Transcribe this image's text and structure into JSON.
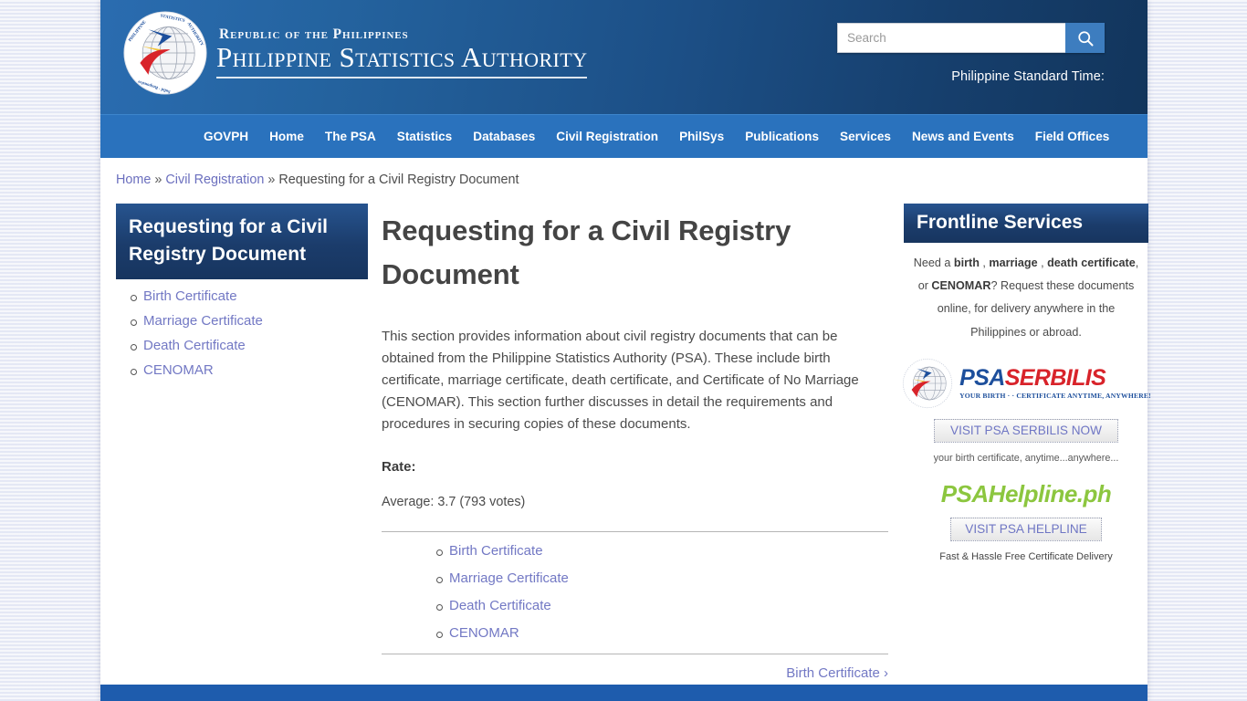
{
  "masthead": {
    "seal_icon": "psa-seal-icon",
    "sub_title": "Republic of the Philippines",
    "main_title": "Philippine Statistics Authority",
    "search": {
      "placeholder": "Search",
      "value": "",
      "button_icon": "search-icon"
    },
    "standard_time_label": "Philippine Standard Time:"
  },
  "nav": {
    "items": [
      "GOVPH",
      "Home",
      "The PSA",
      "Statistics",
      "Databases",
      "Civil Registration",
      "PhilSys",
      "Publications",
      "Services",
      "News and Events",
      "Field Offices"
    ]
  },
  "breadcrumb": {
    "home": "Home",
    "sep1": "»",
    "section": "Civil Registration",
    "sep2": "»",
    "current": "Requesting for a Civil Registry Document"
  },
  "sidebar": {
    "title": "Requesting for a Civil Registry Document",
    "items": [
      "Birth Certificate",
      "Marriage Certificate",
      "Death Certificate",
      "CENOMAR"
    ]
  },
  "main": {
    "title": "Requesting for a Civil Registry Document",
    "intro": "This section provides information about civil registry documents that can be obtained from the Philippine Statistics Authority (PSA). These include birth certificate, marriage certificate, death certificate, and Certificate of No Marriage (CENOMAR). This section further discusses in detail the requirements and procedures in securing copies of these documents.",
    "rate_label": "Rate:",
    "rate_average": "Average: 3.7 (793 votes)",
    "sub_links": [
      "Birth Certificate",
      "Marriage Certificate",
      "Death Certificate",
      "CENOMAR"
    ],
    "pager_next": "Birth Certificate ›"
  },
  "frontline": {
    "title": "Frontline Services",
    "blurb_prefix": "Need a ",
    "b1": "birth",
    "sep1": " , ",
    "b2": "marriage",
    "sep2": " , ",
    "b3": "death certificate",
    "mid": ", or ",
    "b4": "CENOMAR",
    "blurb_suffix": "? Request these documents online, for delivery anywhere in the Philippines or abroad.",
    "serbilis": {
      "seal_icon": "psa-seal-icon",
      "word_psa": "PSA",
      "word_serbilis": "SERBILIS",
      "tagline": "YOUR BIRTH · · CERTIFICATE ANYTIME, ANYWHERE!",
      "button_label": "VISIT PSA SERBILIS NOW",
      "note": "your birth certificate, anytime...anywhere..."
    },
    "helpline": {
      "logo_text": "PSAHelpline.ph",
      "button_label": "VISIT PSA HELPLINE",
      "note": "Fast & Hassle Free Certificate Delivery"
    }
  },
  "colors": {
    "header_blue_light": "#2a6cb0",
    "header_blue_dark": "#12355c",
    "nav_blue": "#2a72bd",
    "panel_navy": "#1b3c6b",
    "link_purple": "#7278c4",
    "footer_blue": "#1e5cad",
    "serbilis_blue": "#1d4f9c",
    "serbilis_red": "#d8232a",
    "helpline_green": "#8cc63f"
  }
}
